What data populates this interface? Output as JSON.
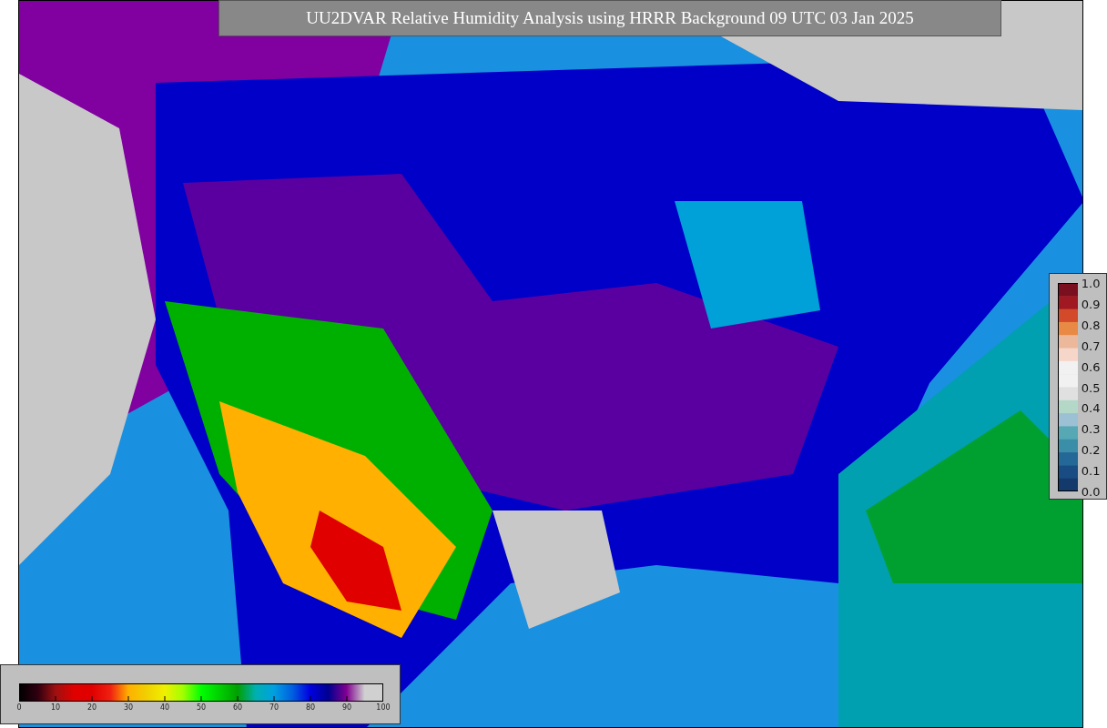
{
  "title": "UU2DVAR Relative Humidity Analysis using HRRR Background 09 UTC 03 Jan 2025",
  "humidity_colorbar": {
    "ticks": [
      "0",
      "10",
      "20",
      "30",
      "40",
      "50",
      "60",
      "70",
      "80",
      "90",
      "100"
    ]
  },
  "ratio_colorbar": {
    "ticks": [
      "1.0",
      "0.9",
      "0.8",
      "0.7",
      "0.6",
      "0.5",
      "0.4",
      "0.3",
      "0.2",
      "0.1",
      "0.0"
    ]
  }
}
